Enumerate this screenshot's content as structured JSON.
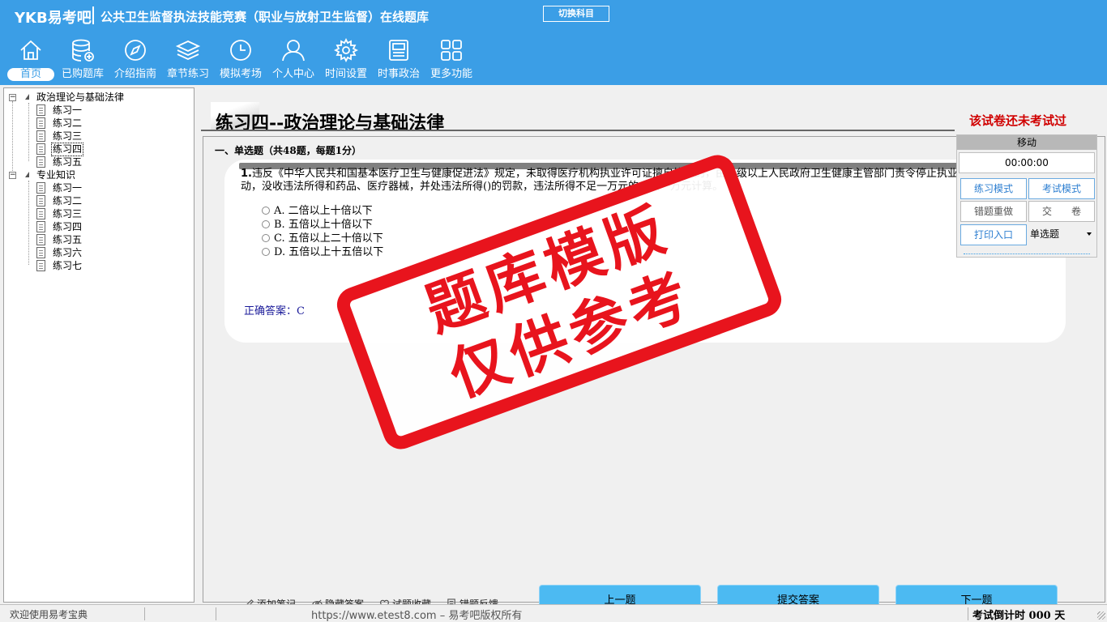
{
  "header": {
    "brand": "YKB易考吧",
    "title": "公共卫生监督执法技能竞赛（职业与放射卫生监督）在线题库",
    "switch_label": "切换科目",
    "nav": [
      {
        "label": "首页",
        "icon": "home-icon"
      },
      {
        "label": "已购题库",
        "icon": "database-icon"
      },
      {
        "label": "介绍指南",
        "icon": "compass-icon"
      },
      {
        "label": "章节练习",
        "icon": "layers-icon"
      },
      {
        "label": "模拟考场",
        "icon": "clock-icon"
      },
      {
        "label": "个人中心",
        "icon": "user-icon"
      },
      {
        "label": "时间设置",
        "icon": "gear-icon"
      },
      {
        "label": "时事政治",
        "icon": "news-icon"
      },
      {
        "label": "更多功能",
        "icon": "grid-icon"
      }
    ]
  },
  "tree": {
    "groups": [
      {
        "label": "政治理论与基础法律",
        "items": [
          "练习一",
          "练习二",
          "练习三",
          "练习四",
          "练习五"
        ],
        "selected": 3
      },
      {
        "label": "专业知识",
        "items": [
          "练习一",
          "练习二",
          "练习三",
          "练习四",
          "练习五",
          "练习六",
          "练习七"
        ]
      }
    ]
  },
  "main": {
    "title": "练习四--政治理论与基础法律",
    "exam_status": "该试卷还未考试过",
    "section": "一、单选题（共48题，每题1分）",
    "question": {
      "number": "1.",
      "text": "违反《中华人民共和国基本医疗卫生与健康促进法》规定，未取得医疗机构执业许可证擅自执业的，由县级以上人民政府卫生健康主管部门责令停止执业活动，没收违法所得和药品、医疗器械，并处违法所得()的罚款，违法所得不足一万元的，按一万元计算。",
      "options": [
        "A. 二倍以上十倍以下",
        "B. 五倍以上十倍以下",
        "C. 五倍以上二十倍以下",
        "D. 五倍以上十五倍以下"
      ],
      "answer": "正确答案：C"
    },
    "tools": [
      "添加笔记",
      "隐藏答案",
      "试题收藏",
      "错题反馈"
    ],
    "buttons": {
      "prev": "上一题",
      "submit": "提交答案",
      "next": "下一题"
    }
  },
  "control": {
    "move": "移动",
    "timer": "00:00:00",
    "practice_mode": "练习模式",
    "exam_mode": "考试模式",
    "redo_wrong": "错题重做",
    "hand_in": "交　　卷",
    "print": "打印入口",
    "question_type": "单选题"
  },
  "stamp": {
    "line1": "题库模版",
    "line2": "仅供参考"
  },
  "status": {
    "welcome": "欢迎使用易考宝典",
    "url": "https://www.etest8.com – 易考吧版权所有",
    "countdown": "考试倒计时 000 天"
  },
  "colors": {
    "header": "#3b9ee6",
    "button": "#4cbaf2",
    "alert": "#d00000",
    "stamp": "#e8141d"
  }
}
